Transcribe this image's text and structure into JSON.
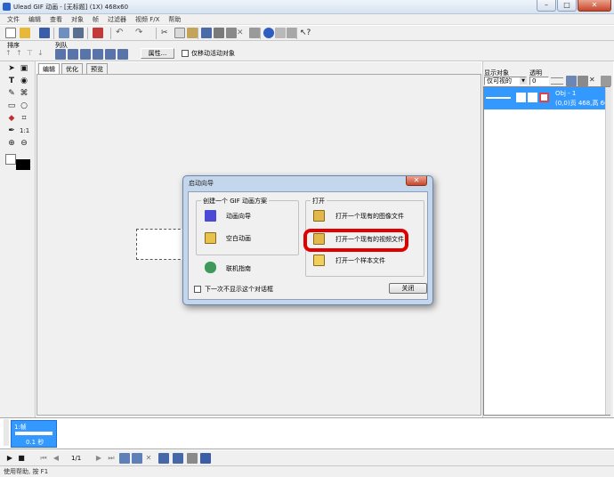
{
  "window": {
    "title": "Ulead GIF 动画 - [无标题] (1X) 468x60"
  },
  "menu": [
    "文件",
    "编辑",
    "查看",
    "对象",
    "帧",
    "过滤器",
    "视频 F/X",
    "帮助"
  ],
  "toolbar2": {
    "order_label": "排序",
    "align_label": "列队",
    "properties_button": "属性...",
    "move_only_active_label": "仅移动活动对象"
  },
  "tabs": [
    "编辑",
    "优化",
    "预览"
  ],
  "right_panel": {
    "show_objects_label": "显示对象",
    "transparency_label": "透明",
    "filter_value": "仅可视的",
    "opacity_value": "0",
    "object_name": "Obj - 1",
    "object_info": "(0,0)页 468,高 60"
  },
  "frame": {
    "label": "1:帧",
    "delay": "0.1 秒"
  },
  "playbar": {
    "frame_counter": "1/1"
  },
  "status": "使用帮助, 按 F1",
  "dialog": {
    "title": "启动向导",
    "create_group_label": "创建一个 GIF 动画方案",
    "animation_wizard": "动画向导",
    "blank_animation": "空白动画",
    "online_guide": "联机指南",
    "open_group_label": "打开",
    "open_image": "打开一个现有的图像文件",
    "open_video": "打开一个现有的视频文件",
    "open_sample": "打开一个样本文件",
    "dont_show_again": "下一次不显示这个对话框",
    "close_button": "关闭"
  },
  "colors": {
    "accent": "#3399ff",
    "highlight_ring": "#e00000",
    "dialog_frame": "#c4d6ec"
  }
}
